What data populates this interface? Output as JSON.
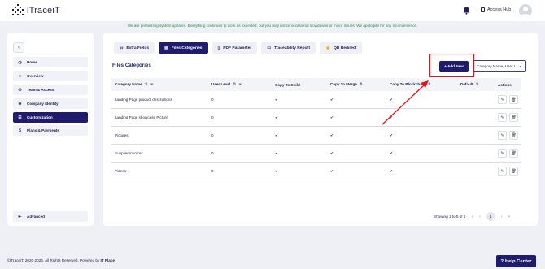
{
  "header": {
    "brand": "iTraceiT",
    "access_hub": "Access Hub"
  },
  "banner": "We are performing system updates. Everything continues to work as expected, but you may notice occasional slowdowns or minor issues. We apologise for any inconvenience.",
  "sidebar": {
    "items": [
      {
        "label": "Home",
        "icon": "clock-icon"
      },
      {
        "label": "Overview",
        "icon": "list-icon"
      },
      {
        "label": "Team & Access",
        "icon": "users-icon"
      },
      {
        "label": "Company Identity",
        "icon": "globe-icon"
      },
      {
        "label": "Customization",
        "icon": "sliders-icon"
      },
      {
        "label": "Plans & Payments",
        "icon": "dollar-icon"
      }
    ],
    "advanced": "Advanced"
  },
  "tabs": [
    {
      "label": "Extra Fields"
    },
    {
      "label": "Files Categories"
    },
    {
      "label": "PDF Parameter"
    },
    {
      "label": "Traceability Report"
    },
    {
      "label": "QR Redirect"
    }
  ],
  "main": {
    "title": "Files Categories",
    "add_new": "+ Add New",
    "column_select": "Category Name, User L..."
  },
  "table": {
    "headers": [
      "Category Name",
      "User Level",
      "Copy To Child",
      "Copy To Merge",
      "Copy To Blockchain",
      "Default",
      "Actions"
    ],
    "rows": [
      {
        "name": "Landing Page product descriptions",
        "level": "0",
        "child": "✔",
        "merge": "✔",
        "blockchain": "✔"
      },
      {
        "name": "Landing Page showcase Picture",
        "level": "0",
        "child": "✔",
        "merge": "✔",
        "blockchain": "✔"
      },
      {
        "name": "Pictures",
        "level": "0",
        "child": "✔",
        "merge": "✔",
        "blockchain": "✔"
      },
      {
        "name": "Supplier invoices",
        "level": "0",
        "child": "✔",
        "merge": "✔",
        "blockchain": "✔"
      },
      {
        "name": "Videos",
        "level": "0",
        "child": "✔",
        "merge": "✔",
        "blockchain": "✔"
      }
    ]
  },
  "pagination": {
    "summary": "Showing 1 to 5 of 5",
    "current": "1"
  },
  "footer": {
    "copyright": "©iTraceiT, 2020-2026, All Rights Reserved. Powered by",
    "powered": "IT Place"
  },
  "help_center": "Help Center",
  "colors": {
    "navy": "#1f1c6b",
    "banner_green": "#2e8b4a",
    "highlight_red": "#e0161b"
  }
}
